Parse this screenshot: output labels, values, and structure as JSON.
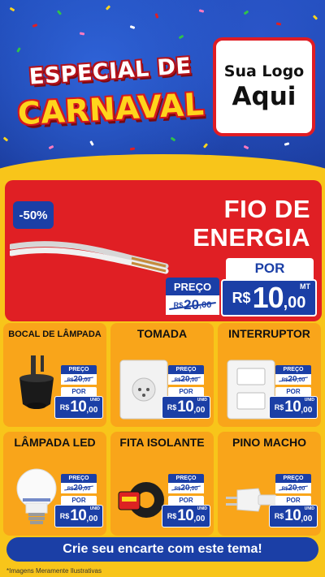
{
  "header": {
    "title_line1": "ESPECIAL DE",
    "title_line2": "CARNAVAL",
    "logo_line1": "Sua Logo",
    "logo_line2": "Aqui"
  },
  "hero": {
    "discount": "-50%",
    "title": "FIO DE ENERGIA",
    "preco_label": "PREÇO",
    "por_label": "POR",
    "old_currency": "R$",
    "old_int": "20",
    "old_cents": ",00",
    "new_currency": "R$",
    "new_int": "10",
    "new_cents": ",00",
    "unit": "MT",
    "image_icon": "cable-icon"
  },
  "products": [
    {
      "name": "BOCAL DE LÂMPADA",
      "icon": "lamp-socket-icon",
      "preco_label": "PREÇO",
      "old_currency": "R$",
      "old_int": "20",
      "old_cents": ",00",
      "por_label": "POR",
      "new_currency": "R$",
      "new_int": "10",
      "new_cents": ",00",
      "unit": "UNID"
    },
    {
      "name": "TOMADA",
      "icon": "outlet-icon",
      "preco_label": "PREÇO",
      "old_currency": "R$",
      "old_int": "20",
      "old_cents": ",00",
      "por_label": "POR",
      "new_currency": "R$",
      "new_int": "10",
      "new_cents": ",00",
      "unit": "UNID"
    },
    {
      "name": "INTERRUPTOR",
      "icon": "switch-icon",
      "preco_label": "PREÇO",
      "old_currency": "R$",
      "old_int": "20",
      "old_cents": ",00",
      "por_label": "POR",
      "new_currency": "R$",
      "new_int": "10",
      "new_cents": ",00",
      "unit": "UNID"
    },
    {
      "name": "LÂMPADA LED",
      "icon": "led-bulb-icon",
      "preco_label": "PREÇO",
      "old_currency": "R$",
      "old_int": "20",
      "old_cents": ",00",
      "por_label": "POR",
      "new_currency": "R$",
      "new_int": "10",
      "new_cents": ",00",
      "unit": "UNID"
    },
    {
      "name": "FITA ISOLANTE",
      "icon": "tape-icon",
      "preco_label": "PREÇO",
      "old_currency": "R$",
      "old_int": "20",
      "old_cents": ",00",
      "por_label": "POR",
      "new_currency": "R$",
      "new_int": "10",
      "new_cents": ",00",
      "unit": "UNID"
    },
    {
      "name": "PINO MACHO",
      "icon": "plug-icon",
      "preco_label": "PREÇO",
      "old_currency": "R$",
      "old_int": "20",
      "old_cents": ",00",
      "por_label": "POR",
      "new_currency": "R$",
      "new_int": "10",
      "new_cents": ",00",
      "unit": "UNID"
    }
  ],
  "cta": {
    "label": "Crie seu encarte com este tema!"
  },
  "footer": {
    "note": "*Imagens Meramente Ilustrativas"
  },
  "colors": {
    "blue": "#1b3fa6",
    "red": "#e01f24",
    "yellow": "#f8c51a",
    "orange_card": "#f9a51a"
  }
}
